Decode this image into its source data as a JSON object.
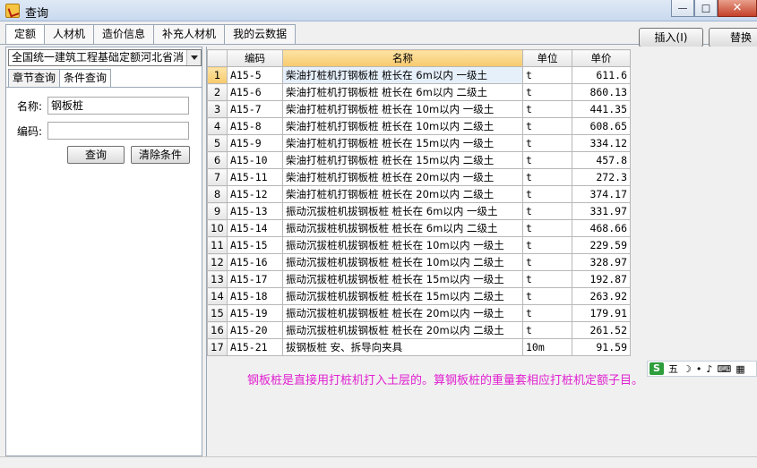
{
  "window": {
    "title": "查询"
  },
  "top_tabs": [
    "定额",
    "人材机",
    "造价信息",
    "补充人材机",
    "我的云数据"
  ],
  "right_buttons": {
    "insert": "插入(I)",
    "replace": "替换"
  },
  "left": {
    "combo_value": "全国统一建筑工程基础定额河北省消",
    "sub_tabs": [
      "章节查询",
      "条件查询"
    ],
    "name_label": "名称:",
    "name_value": "钢板桩",
    "code_label": "编码:",
    "code_value": "",
    "query_button": "查询",
    "clear_button": "清除条件"
  },
  "grid": {
    "headers": [
      "编码",
      "名称",
      "单位",
      "单价"
    ],
    "rows": [
      {
        "n": "1",
        "code": "A15-5",
        "name": "柴油打桩机打钢板桩 桩长在 6m以内 一级土",
        "unit": "t",
        "price": "611.6"
      },
      {
        "n": "2",
        "code": "A15-6",
        "name": "柴油打桩机打钢板桩 桩长在 6m以内 二级土",
        "unit": "t",
        "price": "860.13"
      },
      {
        "n": "3",
        "code": "A15-7",
        "name": "柴油打桩机打钢板桩 桩长在 10m以内 一级土",
        "unit": "t",
        "price": "441.35"
      },
      {
        "n": "4",
        "code": "A15-8",
        "name": "柴油打桩机打钢板桩 桩长在 10m以内 二级土",
        "unit": "t",
        "price": "608.65"
      },
      {
        "n": "5",
        "code": "A15-9",
        "name": "柴油打桩机打钢板桩 桩长在 15m以内 一级土",
        "unit": "t",
        "price": "334.12"
      },
      {
        "n": "6",
        "code": "A15-10",
        "name": "柴油打桩机打钢板桩 桩长在 15m以内 二级土",
        "unit": "t",
        "price": "457.8"
      },
      {
        "n": "7",
        "code": "A15-11",
        "name": "柴油打桩机打钢板桩 桩长在 20m以内 一级土",
        "unit": "t",
        "price": "272.3"
      },
      {
        "n": "8",
        "code": "A15-12",
        "name": "柴油打桩机打钢板桩 桩长在 20m以内 二级土",
        "unit": "t",
        "price": "374.17"
      },
      {
        "n": "9",
        "code": "A15-13",
        "name": "振动沉拔桩机拔钢板桩 桩长在 6m以内 一级土",
        "unit": "t",
        "price": "331.97"
      },
      {
        "n": "10",
        "code": "A15-14",
        "name": "振动沉拔桩机拔钢板桩 桩长在 6m以内 二级土",
        "unit": "t",
        "price": "468.66"
      },
      {
        "n": "11",
        "code": "A15-15",
        "name": "振动沉拔桩机拔钢板桩 桩长在 10m以内 一级土",
        "unit": "t",
        "price": "229.59"
      },
      {
        "n": "12",
        "code": "A15-16",
        "name": "振动沉拔桩机拔钢板桩 桩长在 10m以内 二级土",
        "unit": "t",
        "price": "328.97"
      },
      {
        "n": "13",
        "code": "A15-17",
        "name": "振动沉拔桩机拔钢板桩 桩长在 15m以内 一级土",
        "unit": "t",
        "price": "192.87"
      },
      {
        "n": "14",
        "code": "A15-18",
        "name": "振动沉拔桩机拔钢板桩 桩长在 15m以内 二级土",
        "unit": "t",
        "price": "263.92"
      },
      {
        "n": "15",
        "code": "A15-19",
        "name": "振动沉拔桩机拔钢板桩 桩长在 20m以内 一级土",
        "unit": "t",
        "price": "179.91"
      },
      {
        "n": "16",
        "code": "A15-20",
        "name": "振动沉拔桩机拔钢板桩 桩长在 20m以内 二级土",
        "unit": "t",
        "price": "261.52"
      },
      {
        "n": "17",
        "code": "A15-21",
        "name": "拔钢板桩 安、拆导向夹具",
        "unit": "10m",
        "price": "91.59"
      }
    ]
  },
  "note": "钢板桩是直接用打桩机打入土层的。算钢板桩的重量套相应打桩机定额子目。",
  "ime": {
    "s": "S",
    "mode": "五"
  },
  "colors": {
    "note": "#e020d0",
    "highlight": "#f7c96c"
  }
}
